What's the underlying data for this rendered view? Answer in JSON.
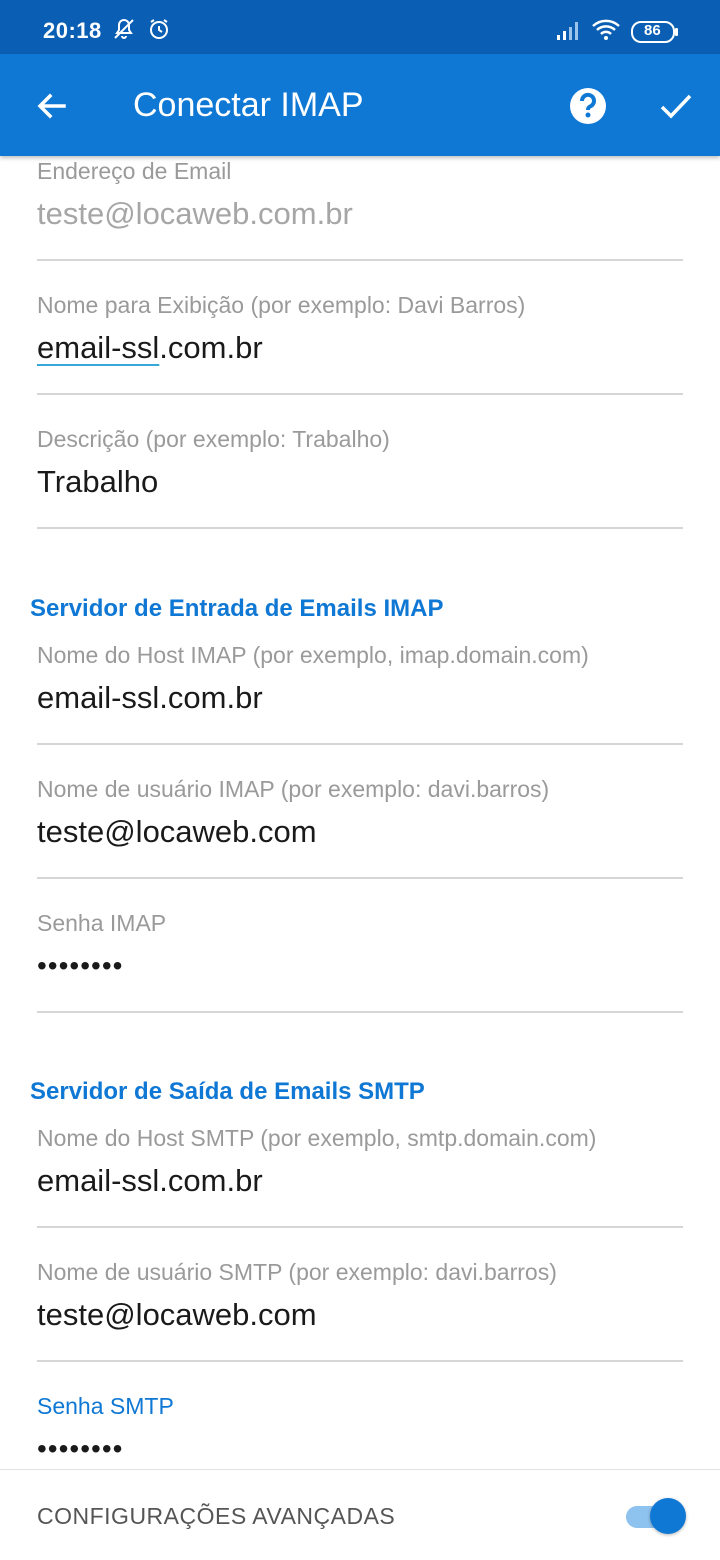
{
  "status_bar": {
    "time": "20:18",
    "battery": "86",
    "icons": [
      "notifications-off-icon",
      "alarm-icon",
      "signal-icon",
      "wifi-icon",
      "battery-icon"
    ]
  },
  "app_bar": {
    "title": "Conectar IMAP",
    "back_icon": "arrow-back-icon",
    "help_icon": "help-icon",
    "confirm_icon": "check-icon",
    "color": "#0f78d4"
  },
  "account": {
    "email_label": "Endereço de Email",
    "email_value": "teste@locaweb.com.br",
    "display_name_label": "Nome para Exibição (por exemplo: Davi Barros)",
    "display_name_value_a": "email-ssl",
    "display_name_value_b": ".com.br",
    "description_label": "Descrição (por exemplo: Trabalho)",
    "description_value": "Trabalho"
  },
  "imap": {
    "section_title": "Servidor de Entrada de Emails IMAP",
    "host_label": "Nome do Host IMAP (por exemplo, imap.domain.com)",
    "host_value": "email-ssl.com.br",
    "user_label": "Nome de usuário IMAP (por exemplo: davi.barros)",
    "user_value": "teste@locaweb.com",
    "password_label": "Senha IMAP",
    "password_value": "••••••••"
  },
  "smtp": {
    "section_title": "Servidor de Saída de Emails SMTP",
    "host_label": "Nome do Host SMTP (por exemplo, smtp.domain.com)",
    "host_value": "email-ssl.com.br",
    "user_label": "Nome de usuário SMTP (por exemplo: davi.barros)",
    "user_value": "teste@locaweb.com",
    "password_label": "Senha SMTP",
    "password_value": "••••••••"
  },
  "advanced": {
    "label": "CONFIGURAÇÕES AVANÇADAS",
    "toggle_on": true
  }
}
